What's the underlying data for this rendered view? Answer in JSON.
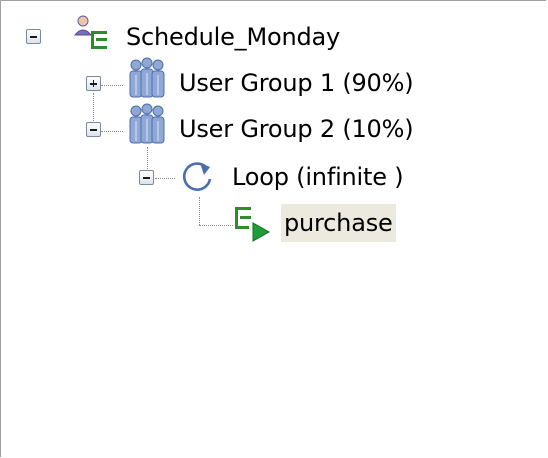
{
  "tree": {
    "root": {
      "label": "Schedule_Monday",
      "icon": "schedule-icon",
      "expanded": true
    },
    "group1": {
      "label": "User Group 1 (90%)",
      "icon": "user-group-icon",
      "expanded": false
    },
    "group2": {
      "label": "User Group 2 (10%)",
      "icon": "user-group-icon",
      "expanded": true
    },
    "loop": {
      "label": "Loop (infinite )",
      "icon": "loop-icon",
      "expanded": true
    },
    "test": {
      "label": "purchase",
      "icon": "test-icon",
      "selected": true
    }
  },
  "colors": {
    "selection": "#eceadf",
    "group_icon": "#7f97c2",
    "schedule_icon": "#2e8b2e",
    "play_icon": "#1e9e3a",
    "loop_icon": "#4a6fb0"
  }
}
